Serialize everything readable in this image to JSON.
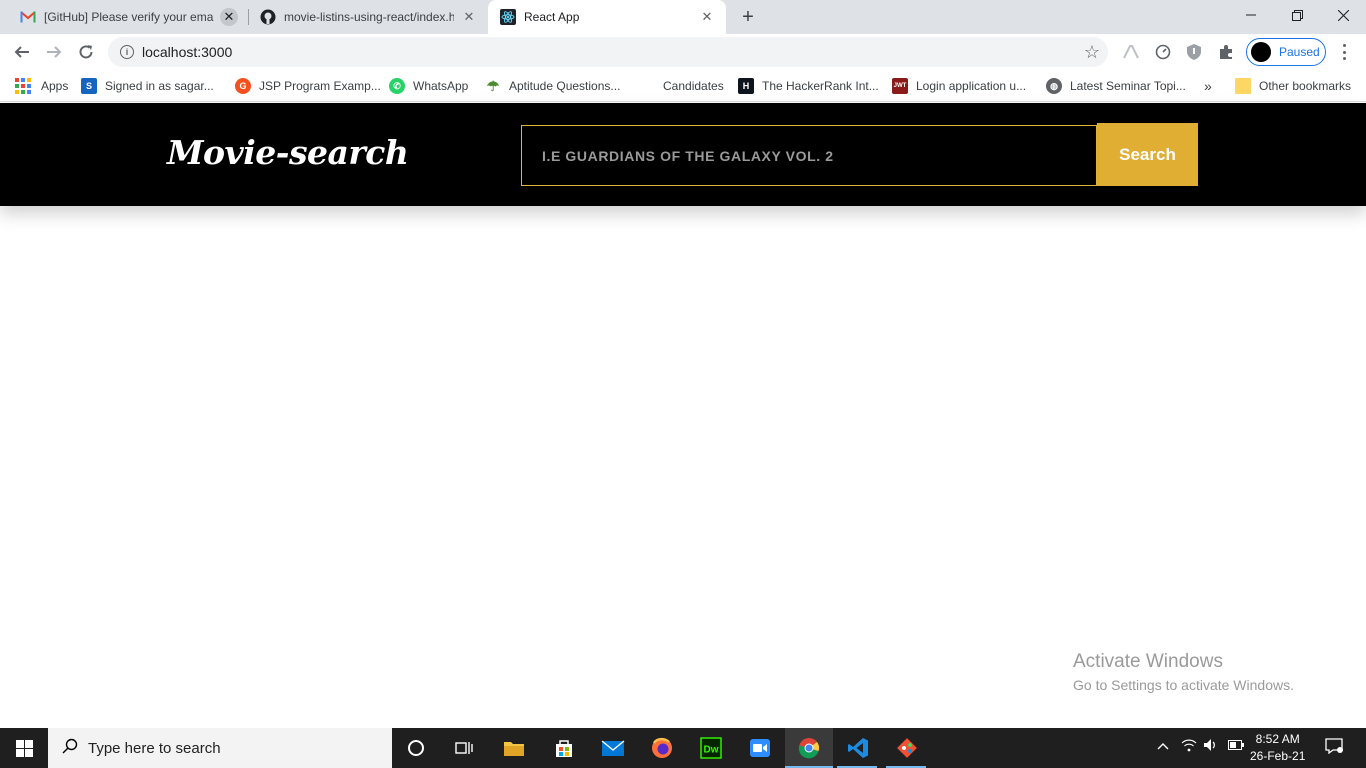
{
  "browser": {
    "tabs": [
      {
        "title": "[GitHub] Please verify your email",
        "icon": "gmail-icon"
      },
      {
        "title": "movie-listins-using-react/index.h",
        "icon": "github-icon"
      },
      {
        "title": "React App",
        "icon": "react-icon",
        "active": true
      }
    ],
    "new_tab_label": "+",
    "url": "localhost:3000",
    "profile_label": "Paused",
    "bookmarks": [
      {
        "label": "Apps",
        "icon": "apps-grid-icon"
      },
      {
        "label": "Signed in as sagar...",
        "icon": "s-icon"
      },
      {
        "label": "JSP Program Examp...",
        "icon": "jsp-icon"
      },
      {
        "label": "WhatsApp",
        "icon": "whatsapp-icon"
      },
      {
        "label": "Aptitude Questions...",
        "icon": "umbrella-icon"
      },
      {
        "label": "Candidates",
        "icon": ""
      },
      {
        "label": "The HackerRank Int...",
        "icon": "hackerrank-icon"
      },
      {
        "label": "Login application u...",
        "icon": "jwt-icon"
      },
      {
        "label": "Latest Seminar Topi...",
        "icon": "globe-icon"
      },
      {
        "label": "Other bookmarks",
        "icon": "folder-icon"
      }
    ],
    "overflow_label": "»"
  },
  "app": {
    "logo": "Movie-search",
    "search_placeholder": "I.E GUARDIANS OF THE GALAXY VOL. 2",
    "search_button": "Search",
    "accent_color": "#dfae32"
  },
  "watermark": {
    "line1": "Activate Windows",
    "line2": "Go to Settings to activate Windows."
  },
  "taskbar": {
    "search_placeholder": "Type here to search",
    "time": "8:52 AM",
    "date": "26-Feb-21",
    "apps": [
      "cortana-icon",
      "task-view-icon",
      "file-explorer-icon",
      "store-icon",
      "mail-icon",
      "firefox-icon",
      "dreamweaver-icon",
      "zoom-icon",
      "chrome-icon",
      "vscode-icon",
      "git-icon"
    ]
  }
}
